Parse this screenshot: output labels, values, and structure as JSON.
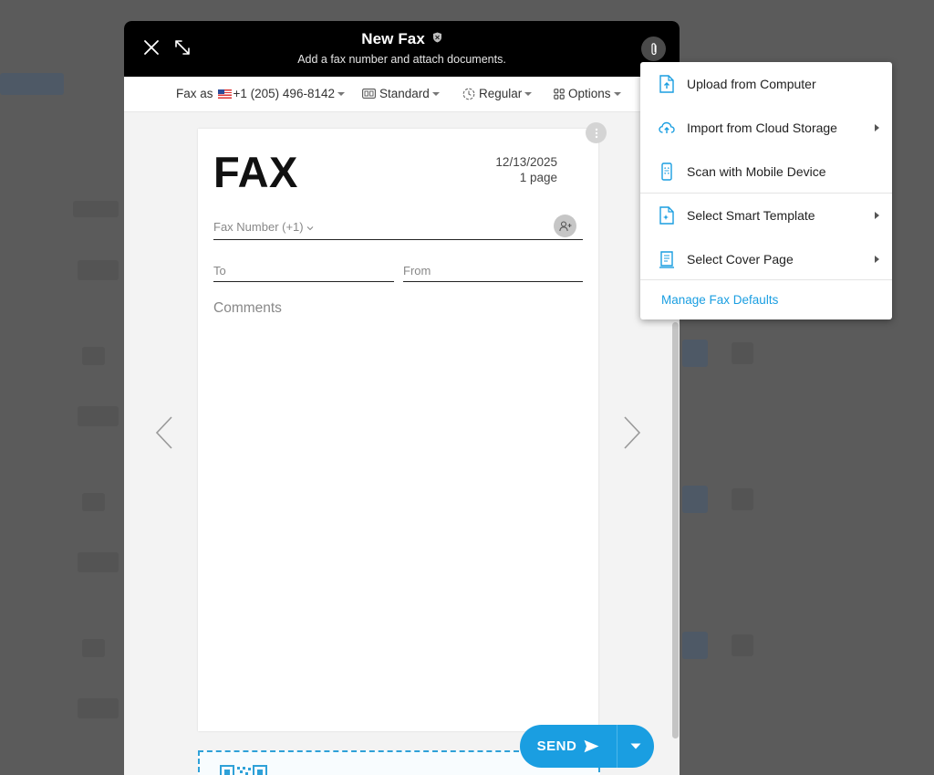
{
  "modal": {
    "title": "New Fax",
    "subtitle": "Add a fax number and attach documents."
  },
  "toolbar": {
    "fax_as_label": "Fax as",
    "fax_as_number": "+1 (205) 496-8142",
    "quality": "Standard",
    "speed": "Regular",
    "options": "Options"
  },
  "cover": {
    "heading": "FAX",
    "date": "12/13/2025",
    "pages": "1 page",
    "fax_number_label": "Fax Number (+1)",
    "to_label": "To",
    "from_label": "From",
    "comments_label": "Comments"
  },
  "send": {
    "label": "SEND"
  },
  "attach_menu": {
    "items": [
      {
        "label": "Upload from Computer",
        "icon": "upload-file-icon"
      },
      {
        "label": "Import from Cloud Storage",
        "icon": "cloud-upload-icon"
      },
      {
        "label": "Scan with Mobile Device",
        "icon": "mobile-scan-icon"
      },
      {
        "label": "Select Smart Template",
        "icon": "smart-template-icon"
      },
      {
        "label": "Select Cover Page",
        "icon": "cover-page-icon"
      }
    ],
    "footer_link": "Manage Fax Defaults"
  },
  "colors": {
    "accent": "#1a9ee1",
    "header_bg": "#000000",
    "overlay_bg": "#5b5b5b"
  }
}
